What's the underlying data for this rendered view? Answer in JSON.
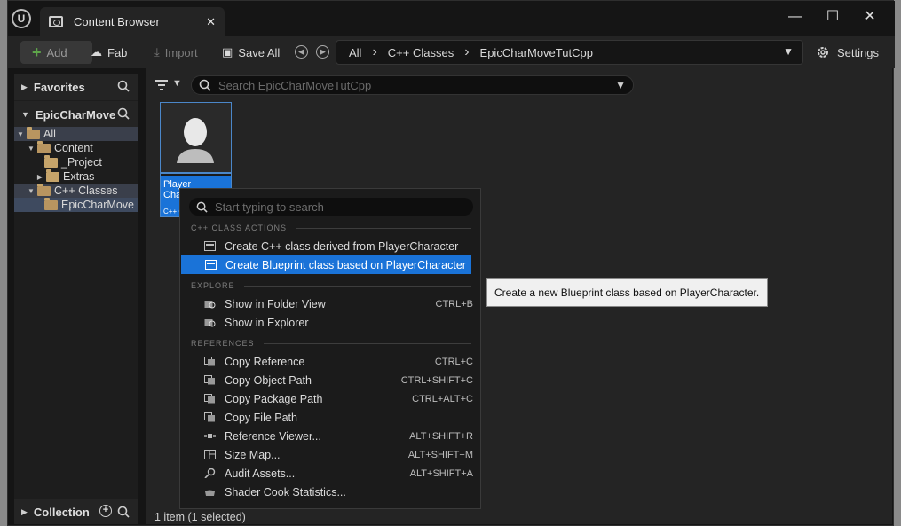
{
  "window": {
    "tab_title": "Content Browser",
    "logo": "U"
  },
  "toolbar": {
    "add_label": "Add",
    "fab_label": "Fab",
    "import_label": "Import",
    "save_all_label": "Save All",
    "breadcrumb": [
      "All",
      "C++ Classes",
      "EpicCharMoveTutCpp"
    ],
    "settings_label": "Settings"
  },
  "left_panel": {
    "favorites_label": "Favorites",
    "project_label": "EpicCharMove",
    "collection_label": "Collection",
    "tree": [
      {
        "label": "All"
      },
      {
        "label": "Content"
      },
      {
        "label": "_Project"
      },
      {
        "label": "Extras"
      },
      {
        "label": "C++ Classes"
      },
      {
        "label": "EpicCharMove"
      }
    ]
  },
  "content": {
    "search_placeholder": "Search EpicCharMoveTutCpp",
    "asset": {
      "line1": "Player",
      "line2": "Chara",
      "type": "C++ Cla"
    },
    "status": "1 item (1 selected)"
  },
  "context_menu": {
    "search_placeholder": "Start typing to search",
    "sections": {
      "cpp": "C++ CLASS ACTIONS",
      "explore": "EXPLORE",
      "references": "REFERENCES"
    },
    "items": [
      {
        "label": "Create C++ class derived from PlayerCharacter",
        "shortcut": ""
      },
      {
        "label": "Create Blueprint class based on PlayerCharacter",
        "shortcut": ""
      },
      {
        "label": "Show in Folder View",
        "shortcut": "CTRL+B"
      },
      {
        "label": "Show in Explorer",
        "shortcut": ""
      },
      {
        "label": "Copy Reference",
        "shortcut": "CTRL+C"
      },
      {
        "label": "Copy Object Path",
        "shortcut": "CTRL+SHIFT+C"
      },
      {
        "label": "Copy Package Path",
        "shortcut": "CTRL+ALT+C"
      },
      {
        "label": "Copy File Path",
        "shortcut": ""
      },
      {
        "label": "Reference Viewer...",
        "shortcut": "ALT+SHIFT+R"
      },
      {
        "label": "Size Map...",
        "shortcut": "ALT+SHIFT+M"
      },
      {
        "label": "Audit Assets...",
        "shortcut": "ALT+SHIFT+A"
      },
      {
        "label": "Shader Cook Statistics...",
        "shortcut": ""
      }
    ]
  },
  "tooltip": {
    "text": "Create a new Blueprint class based on PlayerCharacter."
  },
  "colors": {
    "accent": "#1a73d8",
    "background": "#151515",
    "panel": "#242424"
  }
}
